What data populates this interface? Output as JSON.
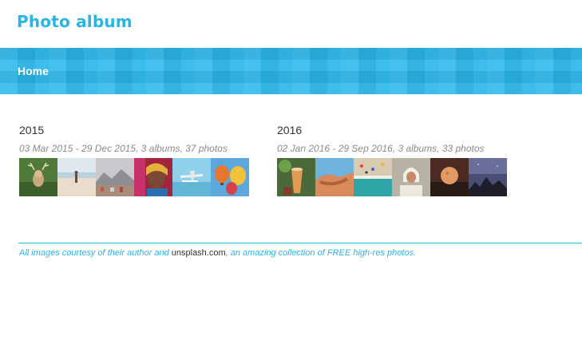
{
  "header": {
    "title": "Photo album"
  },
  "nav": {
    "home_label": "Home"
  },
  "years": [
    {
      "year": "2015",
      "meta": "03 Mar 2015 - 29 Dec 2015, 3 albums, 37 photos",
      "thumbnails": [
        {
          "name": "deer-photo"
        },
        {
          "name": "beach-person-photo"
        },
        {
          "name": "mountain-city-photo"
        },
        {
          "name": "portrait-girl-photo"
        },
        {
          "name": "seaplane-photo"
        },
        {
          "name": "hot-air-balloons-photo"
        }
      ]
    },
    {
      "year": "2016",
      "meta": "02 Jan 2016 - 29 Sep 2016, 3 albums, 33 photos",
      "thumbnails": [
        {
          "name": "drink-photo"
        },
        {
          "name": "hand-sky-photo"
        },
        {
          "name": "aerial-beach-photo"
        },
        {
          "name": "woman-headscarf-photo"
        },
        {
          "name": "moon-photo"
        },
        {
          "name": "mountains-sky-photo"
        }
      ]
    }
  ],
  "footer": {
    "text_before": "All images courtesy of their author and ",
    "link_label": "unsplash.com",
    "text_after": ", an amazing collection of FREE high-res photos."
  }
}
